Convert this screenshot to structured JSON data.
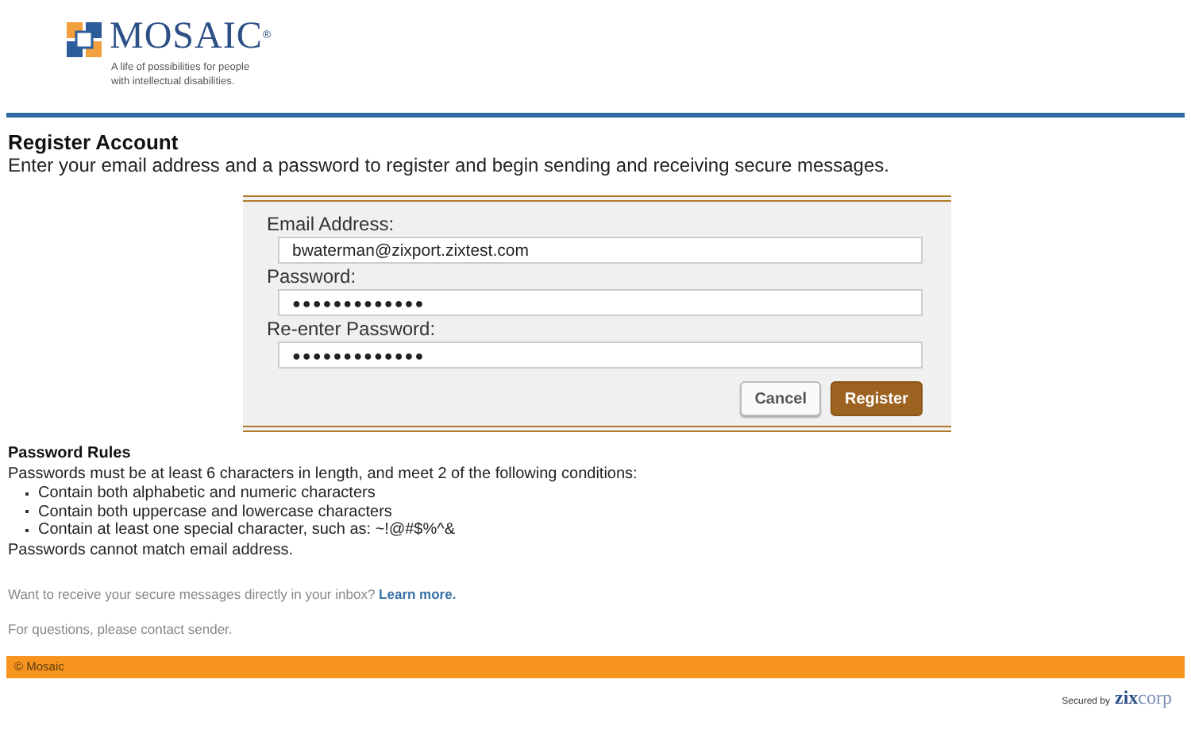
{
  "logo": {
    "name": "MOSAIC",
    "mark": "®",
    "tagline": [
      "A life of possibilities for people",
      "with intellectual disabilities."
    ]
  },
  "heading": "Register Account",
  "intro": "Enter your email address and a password to register and begin sending and receiving secure messages.",
  "form": {
    "fields": [
      {
        "label": "Email Address:",
        "value": "bwaterman@zixport.zixtest.com",
        "kind": "text"
      },
      {
        "label": "Password:",
        "value": "●●●●●●●●●●●●●",
        "kind": "password"
      },
      {
        "label": "Re-enter Password:",
        "value": "●●●●●●●●●●●●●",
        "kind": "password"
      }
    ],
    "buttons": [
      {
        "label": "Cancel",
        "kind": "secondary"
      },
      {
        "label": "Register",
        "kind": "primary"
      }
    ]
  },
  "rules": {
    "title": "Password Rules",
    "text": "Passwords must be at least 6 characters in length, and meet 2 of the following conditions:",
    "items": [
      "Contain both alphabetic and numeric characters",
      "Contain both uppercase and lowercase characters",
      "Contain at least one special character, such as: ~!@#$%^&"
    ],
    "note": "Passwords cannot match email address."
  },
  "inbox": {
    "text": "Want to receive your secure messages directly in your inbox?",
    "link": "Learn more."
  },
  "contact": "For questions, please contact sender.",
  "footer": "© Mosaic",
  "secured": {
    "text": "Secured by",
    "brand_bold": "zix",
    "brand_light": "corp"
  }
}
